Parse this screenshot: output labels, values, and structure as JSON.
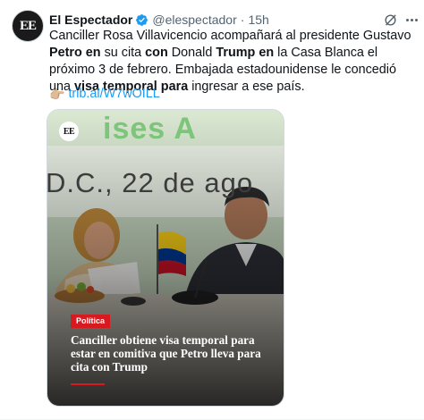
{
  "author": {
    "avatar_text": "EE",
    "name": "El Espectador",
    "handle": "@elespectador",
    "separator": "·",
    "time": "15h"
  },
  "tweet": {
    "text_parts": [
      "Canciller Rosa Villavicencio acompañará al presidente Gustavo ",
      "Petro en",
      " su cita ",
      "con",
      " Donald ",
      "Trump en",
      " la Casa Blanca el próximo 3 de febrero. Embajada estadounidense le concedió una ",
      "visa temporal para",
      " ingresar a ese país."
    ],
    "pointer_emoji": "👉🏼",
    "link": "trib.al/W7wOILL"
  },
  "media": {
    "logo": "EE",
    "background_text_top": "ises A",
    "background_text_city": "D.C., 22 de ago",
    "section": "Política",
    "headline": "Canciller obtiene visa temporal para estar en comitiva que Petro lleva para cita con Trump"
  },
  "icons": {
    "verified": "verified-badge-icon",
    "grok": "grok-icon",
    "more": "more-icon"
  },
  "colors": {
    "verified_blue": "#1d9bf0",
    "link_blue": "#1d9bf0",
    "badge_red": "#d71920"
  }
}
